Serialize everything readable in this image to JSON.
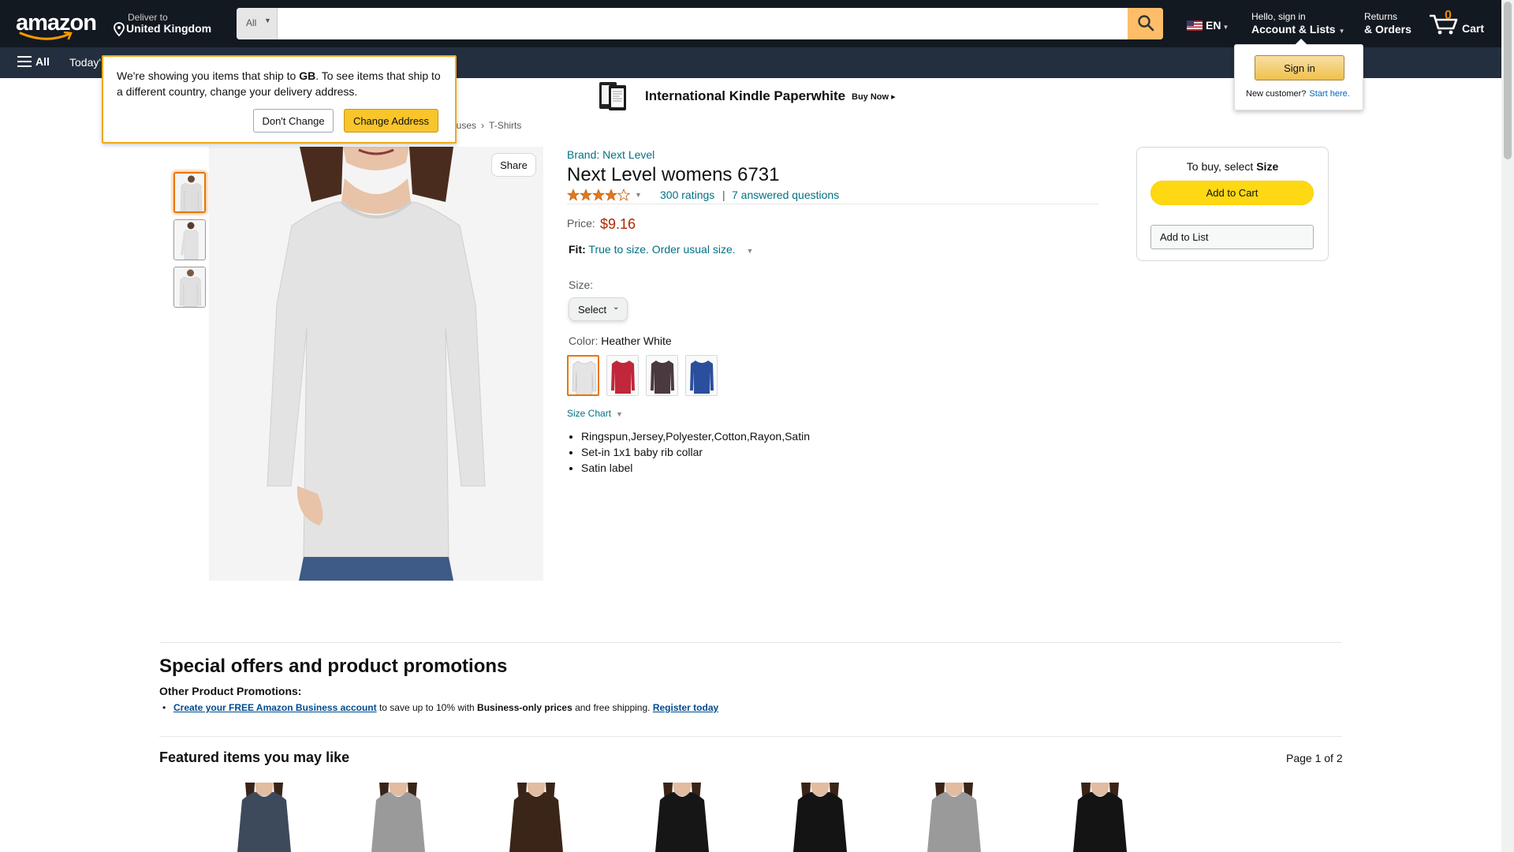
{
  "header": {
    "logo_text": "amazon",
    "deliver_small": "Deliver to",
    "deliver_big": "United Kingdom",
    "search_category": "All",
    "search_placeholder": "",
    "lang": "EN",
    "account_small": "Hello, sign in",
    "account_big": "Account & Lists",
    "returns_small": "Returns",
    "returns_big": "& Orders",
    "cart_count": "0",
    "cart_label": "Cart"
  },
  "subnav": {
    "all_label": "All",
    "today_label": "Today'"
  },
  "banner": {
    "title": "International Kindle Paperwhite",
    "cta": "Buy Now ▸"
  },
  "ship_popover": {
    "msg_before": "We're showing you items that ship to ",
    "country": "GB",
    "msg_after": ". To see items that ship to a different country, change your delivery address.",
    "dont_change": "Don't Change",
    "change_address": "Change Address"
  },
  "signin_popover": {
    "button": "Sign in",
    "new_customer": "New customer?",
    "start_here": "Start here."
  },
  "breadcrumb": {
    "partial": "ouses",
    "sep": "›",
    "last": "T-Shirts"
  },
  "product": {
    "share": "Share",
    "brand": "Brand: Next Level",
    "title": "Next Level womens 6731",
    "rating_value": 4.0,
    "ratings": "300 ratings",
    "separator": "|",
    "questions": "7 answered questions",
    "price_label": "Price:",
    "price": "$9.16",
    "fit_label": "Fit:",
    "fit_value": "True to size. Order usual size.",
    "size_label": "Size:",
    "size_select": "Select",
    "color_label": "Color: ",
    "color_value": "Heather White",
    "swatch_colors": [
      "#e6e6e6",
      "#c0273a",
      "#4a3a40",
      "#2b4f9c"
    ],
    "size_chart": "Size Chart",
    "bullets": [
      "Ringspun,Jersey,Polyester,Cotton,Rayon,Satin",
      "Set-in 1x1 baby rib collar",
      "Satin label"
    ]
  },
  "buybox": {
    "header_prefix": "To buy, select ",
    "header_bold": "Size",
    "add_to_cart": "Add to Cart",
    "add_to_list": "Add to List"
  },
  "promotions": {
    "heading": "Special offers and product promotions",
    "sub": "Other Product Promotions:",
    "link1": "Create your FREE Amazon Business account",
    "text1": " to save up to 10% with ",
    "bold1": "Business-only prices",
    "text2": " and free shipping. ",
    "link2": "Register today"
  },
  "featured": {
    "heading": "Featured items you may like",
    "page": "Page 1 of 2",
    "item_colors": [
      "#3d4a5c",
      "#9a9a9a",
      "#3b2418",
      "#161616",
      "#141414",
      "#9a9a9a",
      "#141414"
    ]
  },
  "colors": {
    "nav_dark": "#131921",
    "nav_secondary": "#232f3e",
    "accent_orange": "#febd69",
    "link_teal": "#007185",
    "price_red": "#b12704",
    "cart_yellow": "#ffd814"
  }
}
